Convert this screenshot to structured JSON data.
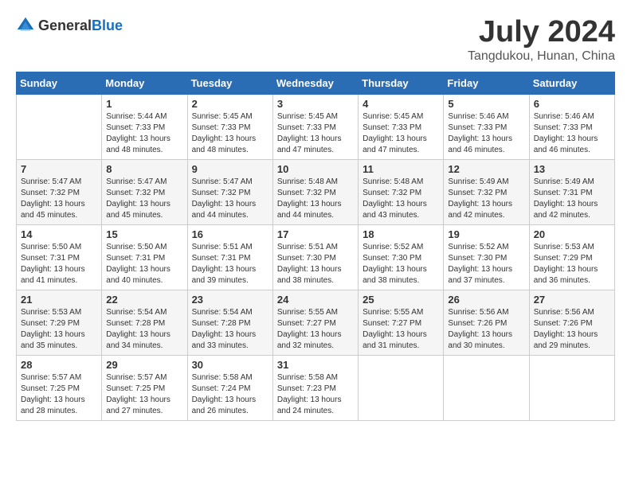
{
  "header": {
    "logo_general": "General",
    "logo_blue": "Blue",
    "title": "July 2024",
    "location": "Tangdukou, Hunan, China"
  },
  "days_of_week": [
    "Sunday",
    "Monday",
    "Tuesday",
    "Wednesday",
    "Thursday",
    "Friday",
    "Saturday"
  ],
  "weeks": [
    [
      {
        "day": "",
        "info": ""
      },
      {
        "day": "1",
        "info": "Sunrise: 5:44 AM\nSunset: 7:33 PM\nDaylight: 13 hours\nand 48 minutes."
      },
      {
        "day": "2",
        "info": "Sunrise: 5:45 AM\nSunset: 7:33 PM\nDaylight: 13 hours\nand 48 minutes."
      },
      {
        "day": "3",
        "info": "Sunrise: 5:45 AM\nSunset: 7:33 PM\nDaylight: 13 hours\nand 47 minutes."
      },
      {
        "day": "4",
        "info": "Sunrise: 5:45 AM\nSunset: 7:33 PM\nDaylight: 13 hours\nand 47 minutes."
      },
      {
        "day": "5",
        "info": "Sunrise: 5:46 AM\nSunset: 7:33 PM\nDaylight: 13 hours\nand 46 minutes."
      },
      {
        "day": "6",
        "info": "Sunrise: 5:46 AM\nSunset: 7:33 PM\nDaylight: 13 hours\nand 46 minutes."
      }
    ],
    [
      {
        "day": "7",
        "info": "Sunrise: 5:47 AM\nSunset: 7:32 PM\nDaylight: 13 hours\nand 45 minutes."
      },
      {
        "day": "8",
        "info": "Sunrise: 5:47 AM\nSunset: 7:32 PM\nDaylight: 13 hours\nand 45 minutes."
      },
      {
        "day": "9",
        "info": "Sunrise: 5:47 AM\nSunset: 7:32 PM\nDaylight: 13 hours\nand 44 minutes."
      },
      {
        "day": "10",
        "info": "Sunrise: 5:48 AM\nSunset: 7:32 PM\nDaylight: 13 hours\nand 44 minutes."
      },
      {
        "day": "11",
        "info": "Sunrise: 5:48 AM\nSunset: 7:32 PM\nDaylight: 13 hours\nand 43 minutes."
      },
      {
        "day": "12",
        "info": "Sunrise: 5:49 AM\nSunset: 7:32 PM\nDaylight: 13 hours\nand 42 minutes."
      },
      {
        "day": "13",
        "info": "Sunrise: 5:49 AM\nSunset: 7:31 PM\nDaylight: 13 hours\nand 42 minutes."
      }
    ],
    [
      {
        "day": "14",
        "info": "Sunrise: 5:50 AM\nSunset: 7:31 PM\nDaylight: 13 hours\nand 41 minutes."
      },
      {
        "day": "15",
        "info": "Sunrise: 5:50 AM\nSunset: 7:31 PM\nDaylight: 13 hours\nand 40 minutes."
      },
      {
        "day": "16",
        "info": "Sunrise: 5:51 AM\nSunset: 7:31 PM\nDaylight: 13 hours\nand 39 minutes."
      },
      {
        "day": "17",
        "info": "Sunrise: 5:51 AM\nSunset: 7:30 PM\nDaylight: 13 hours\nand 38 minutes."
      },
      {
        "day": "18",
        "info": "Sunrise: 5:52 AM\nSunset: 7:30 PM\nDaylight: 13 hours\nand 38 minutes."
      },
      {
        "day": "19",
        "info": "Sunrise: 5:52 AM\nSunset: 7:30 PM\nDaylight: 13 hours\nand 37 minutes."
      },
      {
        "day": "20",
        "info": "Sunrise: 5:53 AM\nSunset: 7:29 PM\nDaylight: 13 hours\nand 36 minutes."
      }
    ],
    [
      {
        "day": "21",
        "info": "Sunrise: 5:53 AM\nSunset: 7:29 PM\nDaylight: 13 hours\nand 35 minutes."
      },
      {
        "day": "22",
        "info": "Sunrise: 5:54 AM\nSunset: 7:28 PM\nDaylight: 13 hours\nand 34 minutes."
      },
      {
        "day": "23",
        "info": "Sunrise: 5:54 AM\nSunset: 7:28 PM\nDaylight: 13 hours\nand 33 minutes."
      },
      {
        "day": "24",
        "info": "Sunrise: 5:55 AM\nSunset: 7:27 PM\nDaylight: 13 hours\nand 32 minutes."
      },
      {
        "day": "25",
        "info": "Sunrise: 5:55 AM\nSunset: 7:27 PM\nDaylight: 13 hours\nand 31 minutes."
      },
      {
        "day": "26",
        "info": "Sunrise: 5:56 AM\nSunset: 7:26 PM\nDaylight: 13 hours\nand 30 minutes."
      },
      {
        "day": "27",
        "info": "Sunrise: 5:56 AM\nSunset: 7:26 PM\nDaylight: 13 hours\nand 29 minutes."
      }
    ],
    [
      {
        "day": "28",
        "info": "Sunrise: 5:57 AM\nSunset: 7:25 PM\nDaylight: 13 hours\nand 28 minutes."
      },
      {
        "day": "29",
        "info": "Sunrise: 5:57 AM\nSunset: 7:25 PM\nDaylight: 13 hours\nand 27 minutes."
      },
      {
        "day": "30",
        "info": "Sunrise: 5:58 AM\nSunset: 7:24 PM\nDaylight: 13 hours\nand 26 minutes."
      },
      {
        "day": "31",
        "info": "Sunrise: 5:58 AM\nSunset: 7:23 PM\nDaylight: 13 hours\nand 24 minutes."
      },
      {
        "day": "",
        "info": ""
      },
      {
        "day": "",
        "info": ""
      },
      {
        "day": "",
        "info": ""
      }
    ]
  ]
}
